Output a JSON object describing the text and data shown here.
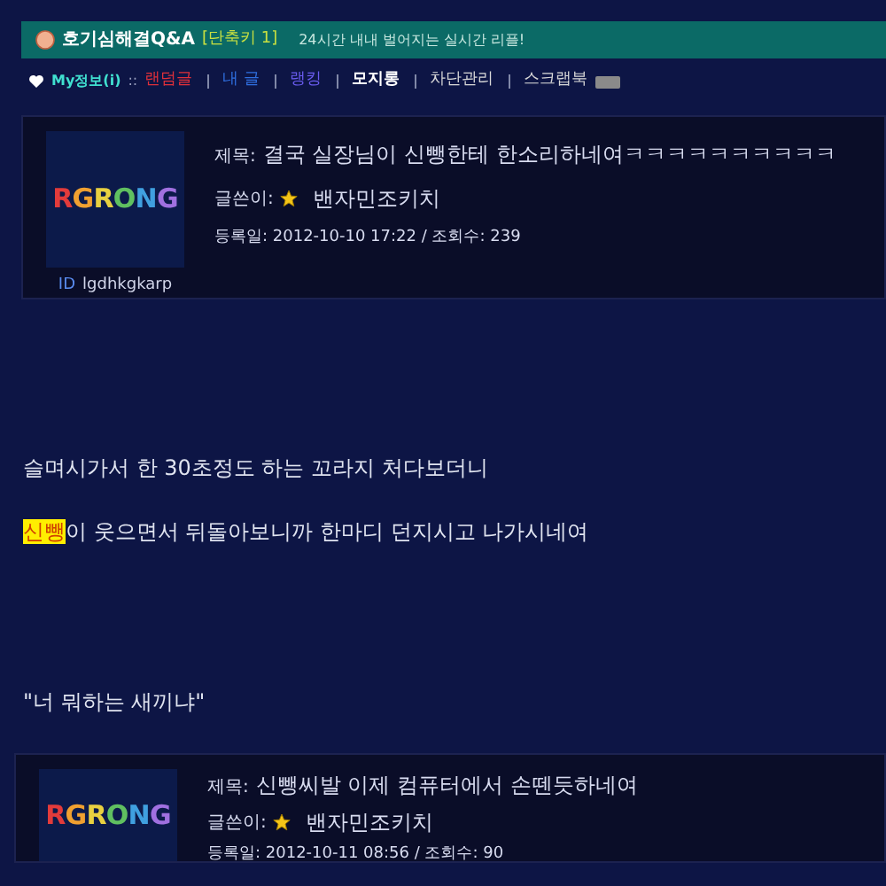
{
  "header": {
    "title": "호기심해결Q&A",
    "shortcut": "[단축키 1]",
    "tagline": "24시간 내내 벌어지는 실시간 리플!"
  },
  "nav": {
    "label": "My정보(i)",
    "separator": "::",
    "items": [
      {
        "label": "랜덤글",
        "color": "#e0303a",
        "selected": false
      },
      {
        "label": "내 글",
        "color": "#2f6fe0",
        "selected": false
      },
      {
        "label": "랭킹",
        "color": "#6a5cf0",
        "selected": false
      },
      {
        "label": "모지롱",
        "color": "#ffffff",
        "selected": true
      },
      {
        "label": "차단관리",
        "color": "#d8d8d8",
        "selected": false
      },
      {
        "label": "스크랩북",
        "color": "#d8d8d8",
        "selected": false,
        "badge": true
      }
    ]
  },
  "posts": [
    {
      "logo": "RGRONG",
      "id_label": "ID",
      "user_id": "lgdhkgkarp",
      "title_label": "제목:",
      "title": "결국 실장님이 신뺑한테 한소리하네여ㅋㅋㅋㅋㅋㅋㅋㅋㅋㅋ",
      "author_label": "글쓴이:",
      "author": "밴자민조키치",
      "meta": "등록일: 2012-10-10 17:22 / 조회수: 239",
      "body": [
        [
          {
            "text": "슬며시가서 한 30초정도 하는 꼬라지 처다보더니",
            "highlight": false
          }
        ],
        [
          {
            "text": "신뺑",
            "highlight": true
          },
          {
            "text": "이 웃으면서 뒤돌아보니까 한마디 던지시고 나가시네여",
            "highlight": false
          }
        ],
        [
          {
            "text": "\"너 뭐하는 새끼냐\"",
            "highlight": false
          }
        ]
      ]
    },
    {
      "logo": "RGRONG",
      "title_label": "제목:",
      "title": "신뺑씨발 이제 컴퓨터에서 손뗀듯하네여",
      "author_label": "글쓴이:",
      "author": "밴자민조키치",
      "meta": "등록일: 2012-10-11 08:56 / 조회수: 90"
    }
  ]
}
